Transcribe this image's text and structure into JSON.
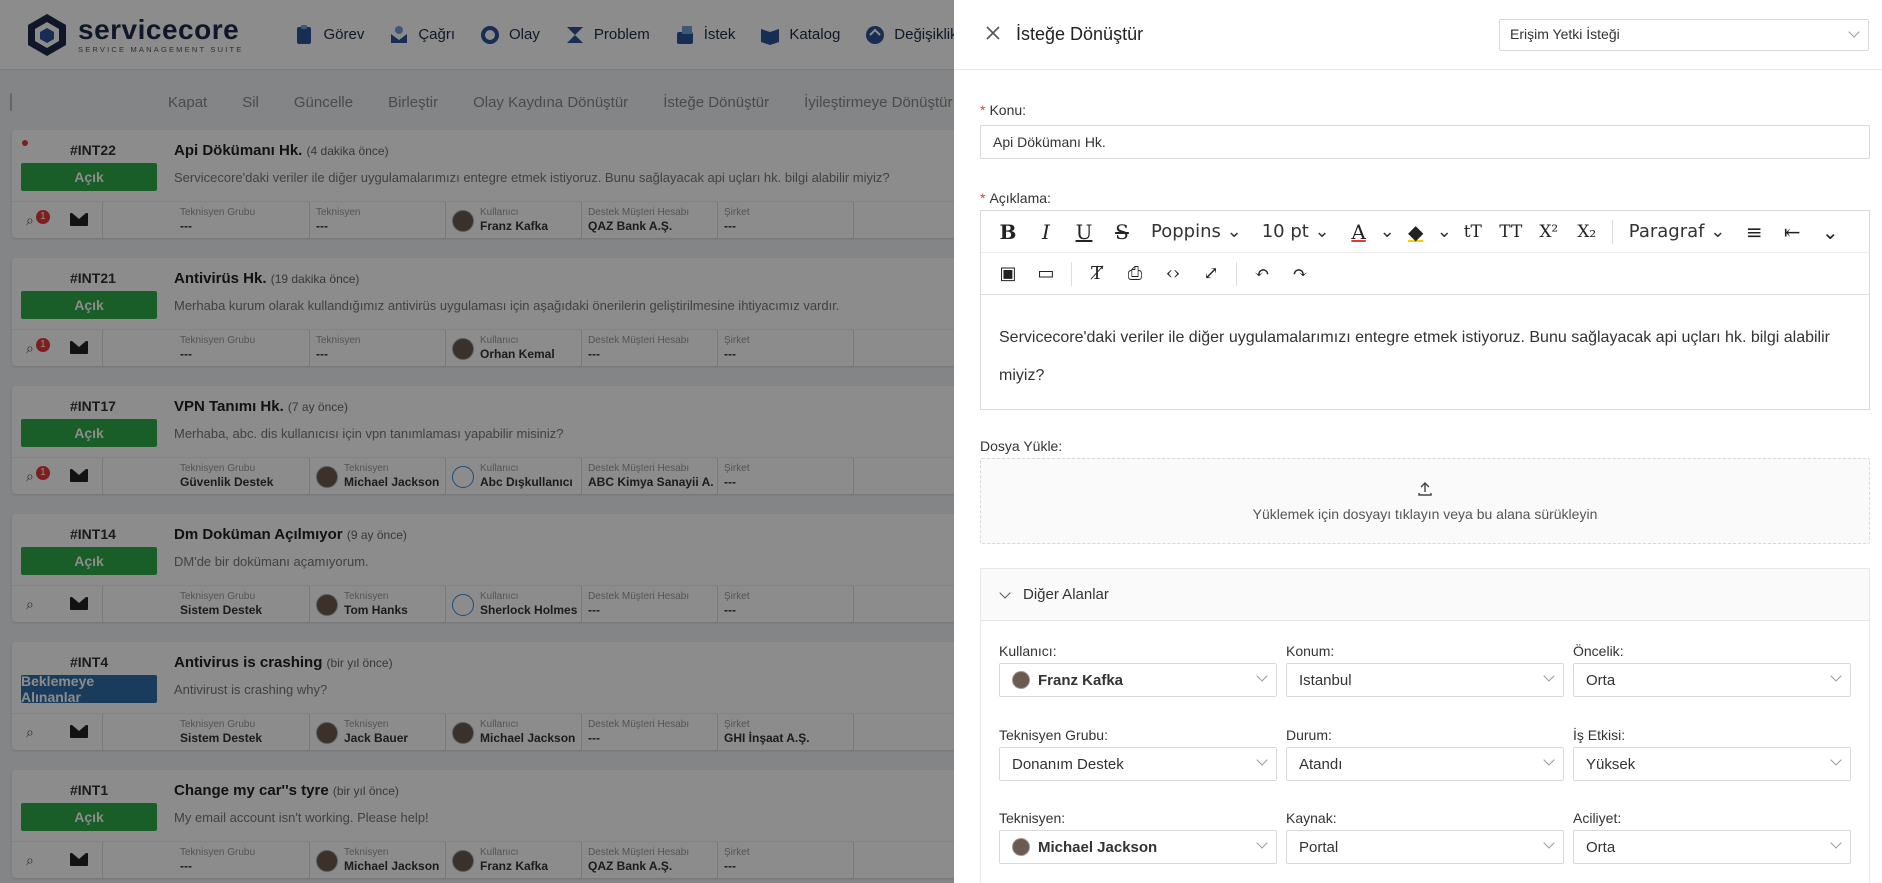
{
  "app": {
    "logo_main": "service",
    "logo_accent": "core",
    "logo_sub": "SERVICE MANAGEMENT SUITE"
  },
  "nav": {
    "items": [
      "Görev",
      "Çağrı",
      "Olay",
      "Problem",
      "İstek",
      "Katalog",
      "Değişiklik"
    ]
  },
  "bulk_actions": [
    "Kapat",
    "Sil",
    "Güncelle",
    "Birleştir",
    "Olay Kaydına Dönüştür",
    "İsteğe Dönüştür",
    "İyileştirmeye Dönüştür"
  ],
  "tickets": [
    {
      "id": "#INT22",
      "status": "Açık",
      "status_color": "#2eaa4a",
      "title": "Api Dökümanı Hk.",
      "age": "(4 dakika önce)",
      "desc": "Servicecore'daki veriler ile diğer uygulamalarımızı entegre etmek istiyoruz. Bunu sağlayacak api uçları hk. bilgi alabilir miyiz?",
      "tech_group": "---",
      "tech": "---",
      "user": "Franz Kafka",
      "account": "QAZ Bank A.Ş.",
      "company": "---",
      "alert": "1",
      "unread": true
    },
    {
      "id": "#INT21",
      "status": "Açık",
      "status_color": "#2eaa4a",
      "title": "Antivirüs Hk.",
      "age": "(19 dakika önce)",
      "desc": "Merhaba kurum olarak kullandığımız antivirüs uygulaması için aşağıdaki önerilerin geliştirilmesine ihtiyacımız vardır.",
      "tech_group": "---",
      "tech": "---",
      "user": "Orhan Kemal",
      "account": "---",
      "company": "---",
      "alert": "1"
    },
    {
      "id": "#INT17",
      "status": "Açık",
      "status_color": "#2eaa4a",
      "title": "VPN Tanımı Hk.",
      "age": "(7 ay önce)",
      "desc": "Merhaba, abc. dis kullanıcısı için vpn tanımlaması yapabilir misiniz?",
      "tech_group": "Güvenlik Destek",
      "tech": "Michael Jackson",
      "user": "Abc Dışkullanıcı",
      "account": "ABC Kimya Sanayii A.",
      "company": "---",
      "alert": "1",
      "user_generic": true
    },
    {
      "id": "#INT14",
      "status": "Açık",
      "status_color": "#2eaa4a",
      "title": "Dm Doküman Açılmıyor",
      "age": "(9 ay önce)",
      "desc": "DM'de bir dokümanı açamıyorum.",
      "tech_group": "Sistem Destek",
      "tech": "Tom Hanks",
      "user": "Sherlock Holmes",
      "account": "---",
      "company": "---",
      "alert": "",
      "user_generic": true
    },
    {
      "id": "#INT4",
      "status": "Beklemeye Alınanlar",
      "status_color": "#2f6ea8",
      "title": "Antivirus is crashing",
      "age": "(bir yıl önce)",
      "desc": "Antivirust is crashing why?",
      "tech_group": "Sistem Destek",
      "tech": "Jack Bauer",
      "user": "Michael Jackson",
      "account": "---",
      "company": "GHI İnşaat A.Ş.",
      "alert": ""
    },
    {
      "id": "#INT1",
      "status": "Açık",
      "status_color": "#2eaa4a",
      "title": "Change my car''s tyre",
      "age": "(bir yıl önce)",
      "desc": "My email account isn't working. Please help!",
      "tech_group": "---",
      "tech": "Michael Jackson",
      "user": "Franz Kafka",
      "account": "QAZ Bank A.Ş.",
      "company": "---",
      "alert": ""
    }
  ],
  "card_labels": {
    "tech_group": "Teknisyen Grubu",
    "tech": "Teknisyen",
    "user": "Kullanıcı",
    "account": "Destek Müşteri Hesabı",
    "company": "Şirket"
  },
  "drawer": {
    "title": "İsteğe Dönüştür",
    "template": "Erişim Yetki İsteği",
    "subject_label": "Konu",
    "subject_value": "Api Dökümanı Hk.",
    "desc_label": "Açıklama",
    "desc_value": "Servicecore'daki veriler ile diğer uygulamalarımızı entegre etmek istiyoruz. Bunu sağlayacak api uçları hk. bilgi alabilir miyiz?",
    "editor": {
      "font": "Poppins",
      "size": "10 pt",
      "block": "Paragraf"
    },
    "upload_label": "Dosya Yükle",
    "upload_hint": "Yüklemek için dosyayı tıklayın veya bu alana sürükleyin",
    "other_fields": "Diğer Alanlar",
    "fields": {
      "user": {
        "label": "Kullanıcı",
        "value": "Franz Kafka"
      },
      "location": {
        "label": "Konum",
        "value": "Istanbul"
      },
      "priority": {
        "label": "Öncelik",
        "value": "Orta"
      },
      "tech_group": {
        "label": "Teknisyen Grubu",
        "value": "Donanım Destek"
      },
      "status": {
        "label": "Durum",
        "value": "Atandı"
      },
      "impact": {
        "label": "İş Etkisi",
        "value": "Yüksek"
      },
      "tech": {
        "label": "Teknisyen",
        "value": "Michael Jackson"
      },
      "source": {
        "label": "Kaynak",
        "value": "Portal"
      },
      "urgency": {
        "label": "Aciliyet",
        "value": "Orta"
      }
    }
  },
  "colors": {
    "accent": "#2a5298",
    "open": "#2eaa4a",
    "hold": "#2f6ea8",
    "required": "#e53935"
  }
}
